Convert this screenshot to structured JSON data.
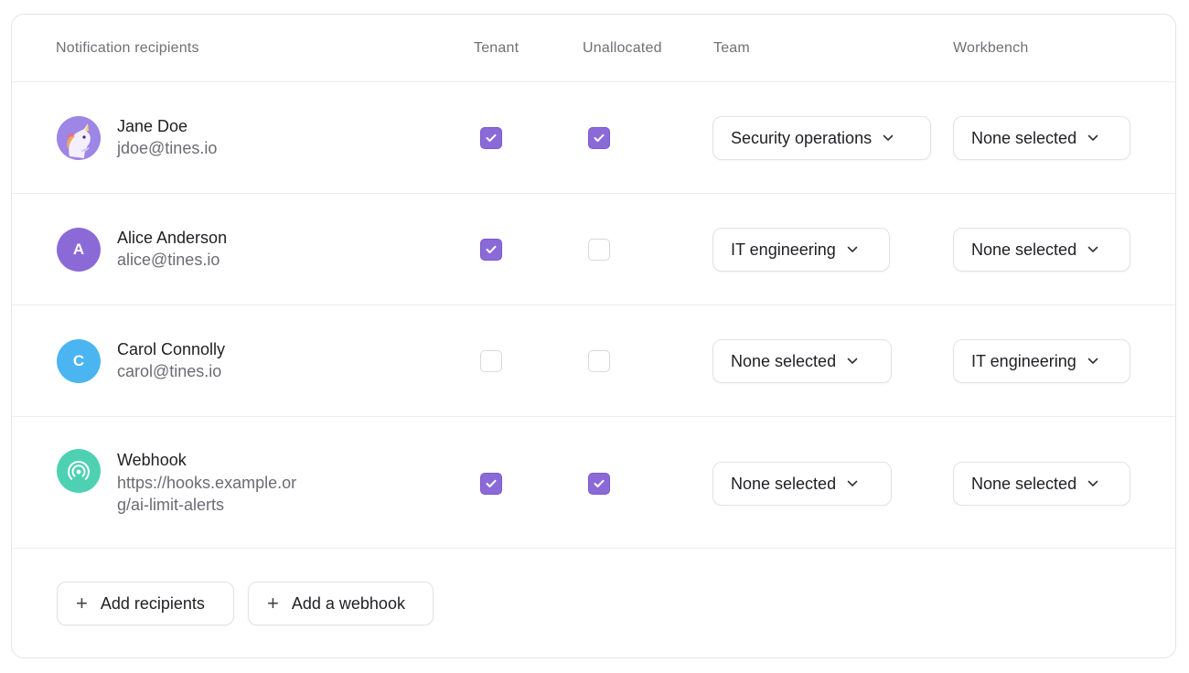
{
  "header": {
    "recipients": "Notification recipients",
    "tenant": "Tenant",
    "unallocated": "Unallocated",
    "team": "Team",
    "workbench": "Workbench"
  },
  "rows": [
    {
      "name": "Jane Doe",
      "email": "jdoe@tines.io",
      "avatar_icon": "unicorn-avatar",
      "tenant": true,
      "unallocated": true,
      "team": "Security operations",
      "workbench": "None selected"
    },
    {
      "name": "Alice Anderson",
      "email": "alice@tines.io",
      "avatar_initial": "A",
      "avatar_color": "#8b6ad8",
      "tenant": true,
      "unallocated": false,
      "team": "IT engineering",
      "workbench": "None selected"
    },
    {
      "name": "Carol Connolly",
      "email": "carol@tines.io",
      "avatar_initial": "C",
      "avatar_color": "#4ab5f0",
      "tenant": false,
      "unallocated": false,
      "team": "None selected",
      "workbench": "IT engineering"
    },
    {
      "name": "Webhook",
      "url_line1": "https://hooks.example.or",
      "url_line2": "g/ai-limit-alerts",
      "avatar_icon": "webhook-broadcast-icon",
      "avatar_color": "#4ed1b2",
      "tenant": true,
      "unallocated": true,
      "team": "None selected",
      "workbench": "None selected"
    }
  ],
  "actions": {
    "add_recipients": "Add recipients",
    "add_webhook": "Add a webhook"
  },
  "colors": {
    "checkbox_on": "#8b6ad8",
    "border": "#e4e4e9"
  }
}
